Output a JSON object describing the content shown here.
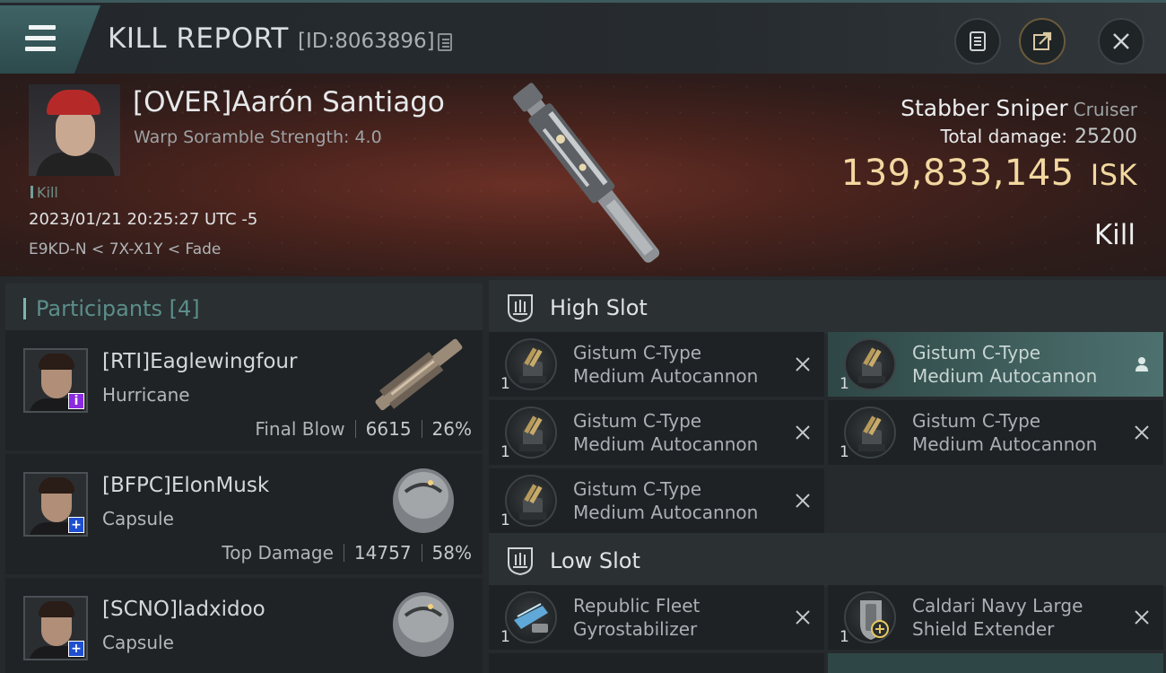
{
  "header": {
    "title": "KILL REPORT",
    "report_id": "[ID:8063896]"
  },
  "victim": {
    "name": "[OVER]Aarón Santiago",
    "warp_scramble": "Warp Soramble Strength: 4.0",
    "kill_tag": "Kill",
    "datetime": "2023/01/21 20:25:27 UTC -5",
    "location": "E9KD-N < 7X-X1Y < Fade",
    "ship_name": "Stabber Sniper",
    "ship_class": "Cruiser",
    "total_damage_label": "Total damage:",
    "total_damage_value": "25200",
    "isk_value": "139,833,145",
    "isk_unit": "ISK",
    "result": "Kill"
  },
  "participants": {
    "header": "Participants",
    "count": "[4]",
    "items": [
      {
        "name": "[RTI]Eaglewingfour",
        "ship": "Hurricane",
        "note": "Final Blow",
        "damage": "6615",
        "percent": "26%",
        "badge": "i",
        "badge_color": "#8a2be2"
      },
      {
        "name": "[BFPC]ElonMusk",
        "ship": "Capsule",
        "note": "Top Damage",
        "damage": "14757",
        "percent": "58%",
        "badge": "+",
        "badge_color": "#1f4fd0"
      },
      {
        "name": "[SCNO]ladxidoo",
        "ship": "Capsule",
        "note": "",
        "damage": "",
        "percent": "",
        "badge": "+",
        "badge_color": "#1f4fd0"
      }
    ]
  },
  "fitting": {
    "high_slot_label": "High Slot",
    "low_slot_label": "Low Slot",
    "high_slot": [
      {
        "qty": "1",
        "name1": "Gistum C-Type",
        "name2": "Medium Autocannon",
        "action": "close-icon"
      },
      {
        "qty": "1",
        "name1": "Gistum C-Type",
        "name2": "Medium Autocannon",
        "action": "person-icon"
      },
      {
        "qty": "1",
        "name1": "Gistum C-Type",
        "name2": "Medium Autocannon",
        "action": "close-icon"
      },
      {
        "qty": "1",
        "name1": "Gistum C-Type",
        "name2": "Medium Autocannon",
        "action": "close-icon"
      },
      {
        "qty": "1",
        "name1": "Gistum C-Type",
        "name2": "Medium Autocannon",
        "action": "close-icon"
      }
    ],
    "low_slot": [
      {
        "qty": "1",
        "name1": "Republic Fleet",
        "name2": "Gyrostabilizer",
        "action": "close-icon"
      },
      {
        "qty": "1",
        "name1": "Caldari Navy Large",
        "name2": "Shield Extender",
        "action": "close-icon"
      }
    ]
  },
  "colors": {
    "accent": "#7ab6b0",
    "isk": "#f2d8a0",
    "active_module": "#4d716f"
  }
}
